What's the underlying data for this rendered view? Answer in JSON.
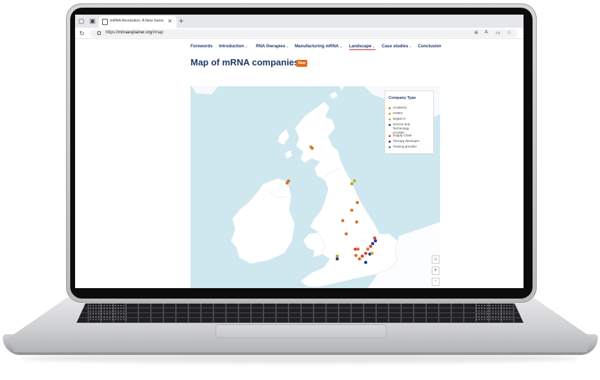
{
  "browser": {
    "tab_title": "mRNA Revolution: A New Gene...",
    "url_prefix": "https://",
    "url_host": "mrnaexplainer.org",
    "url_path": "/#map"
  },
  "nav": {
    "items": [
      {
        "label": "Forewords",
        "chevron": ""
      },
      {
        "label": "Introduction",
        "chevron": "⌄"
      },
      {
        "label": "RNA therapies",
        "chevron": "⌄"
      },
      {
        "label": "Manufacturing mRNA",
        "chevron": "⌄"
      },
      {
        "label": "Landscape",
        "chevron": "⌄"
      },
      {
        "label": "Case studies",
        "chevron": "⌄"
      },
      {
        "label": "Conclusion",
        "chevron": ""
      }
    ],
    "active": "Landscape"
  },
  "page": {
    "title": "Map of mRNA companies",
    "badge": "New"
  },
  "legend": {
    "title": "Company Type",
    "items": [
      {
        "label": "Academic",
        "color": "#d9722a"
      },
      {
        "label": "CDMO",
        "color": "#c9a227"
      },
      {
        "label": "Digital AI",
        "color": "#a9b63a"
      },
      {
        "label": "Service and Technology provider",
        "color": "#2b3a8f"
      },
      {
        "label": "Supply Chain",
        "color": "#d8433b"
      },
      {
        "label": "Therapy developer",
        "color": "#1d3f91"
      },
      {
        "label": "Training provider",
        "color": "#2e9a72"
      }
    ]
  },
  "map_controls": {
    "home": "⌂",
    "zoom_in": "+",
    "zoom_out": "-"
  },
  "colors": {
    "sea": "#cfe7ef",
    "land": "#ffffff",
    "brand_navy": "#1f3a68",
    "badge": "#e06b16",
    "active_underline": "#c8322b"
  }
}
